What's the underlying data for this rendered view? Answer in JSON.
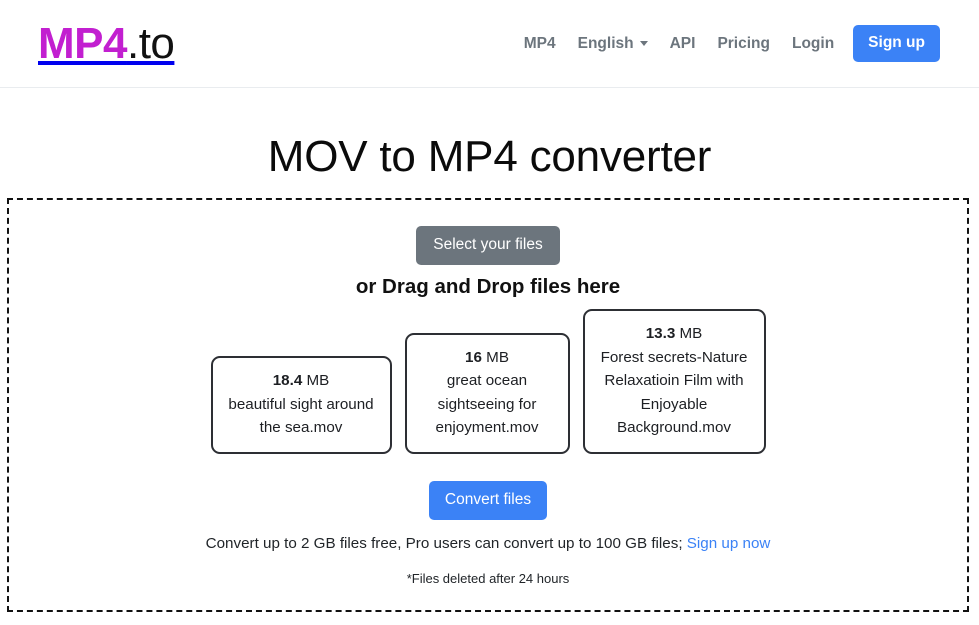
{
  "brand": {
    "mark": "MP4",
    "tld": ".to",
    "mark_color": "#c21fd0"
  },
  "nav": {
    "items": [
      {
        "label": "MP4",
        "icon": null
      },
      {
        "label": "English",
        "icon": "chevron-down-icon"
      },
      {
        "label": "API",
        "icon": null
      },
      {
        "label": "Pricing",
        "icon": null
      },
      {
        "label": "Login",
        "icon": null
      }
    ],
    "signup_label": "Sign up",
    "signup_color": "#3b82f6"
  },
  "page": {
    "title": "MOV to MP4 converter"
  },
  "dropzone": {
    "select_files_label": "Select your files",
    "select_files_color": "#6c757d",
    "drag_hint": "or Drag and Drop files here",
    "files": [
      {
        "size_value": "18.4",
        "size_unit": "MB",
        "name": "beautiful sight around the sea.mov"
      },
      {
        "size_value": "16",
        "size_unit": "MB",
        "name": "great ocean sightseeing for enjoyment.mov"
      },
      {
        "size_value": "13.3",
        "size_unit": "MB",
        "name": "Forest secrets-Nature Relaxatioin Film with Enjoyable Background.mov"
      }
    ],
    "convert_label": "Convert files",
    "convert_color": "#3b82f6",
    "limits_text": "Convert up to 2 GB files free, Pro users can convert up to 100 GB files; ",
    "limits_link_label": "Sign up now",
    "delete_note": "*Files deleted after 24 hours"
  }
}
